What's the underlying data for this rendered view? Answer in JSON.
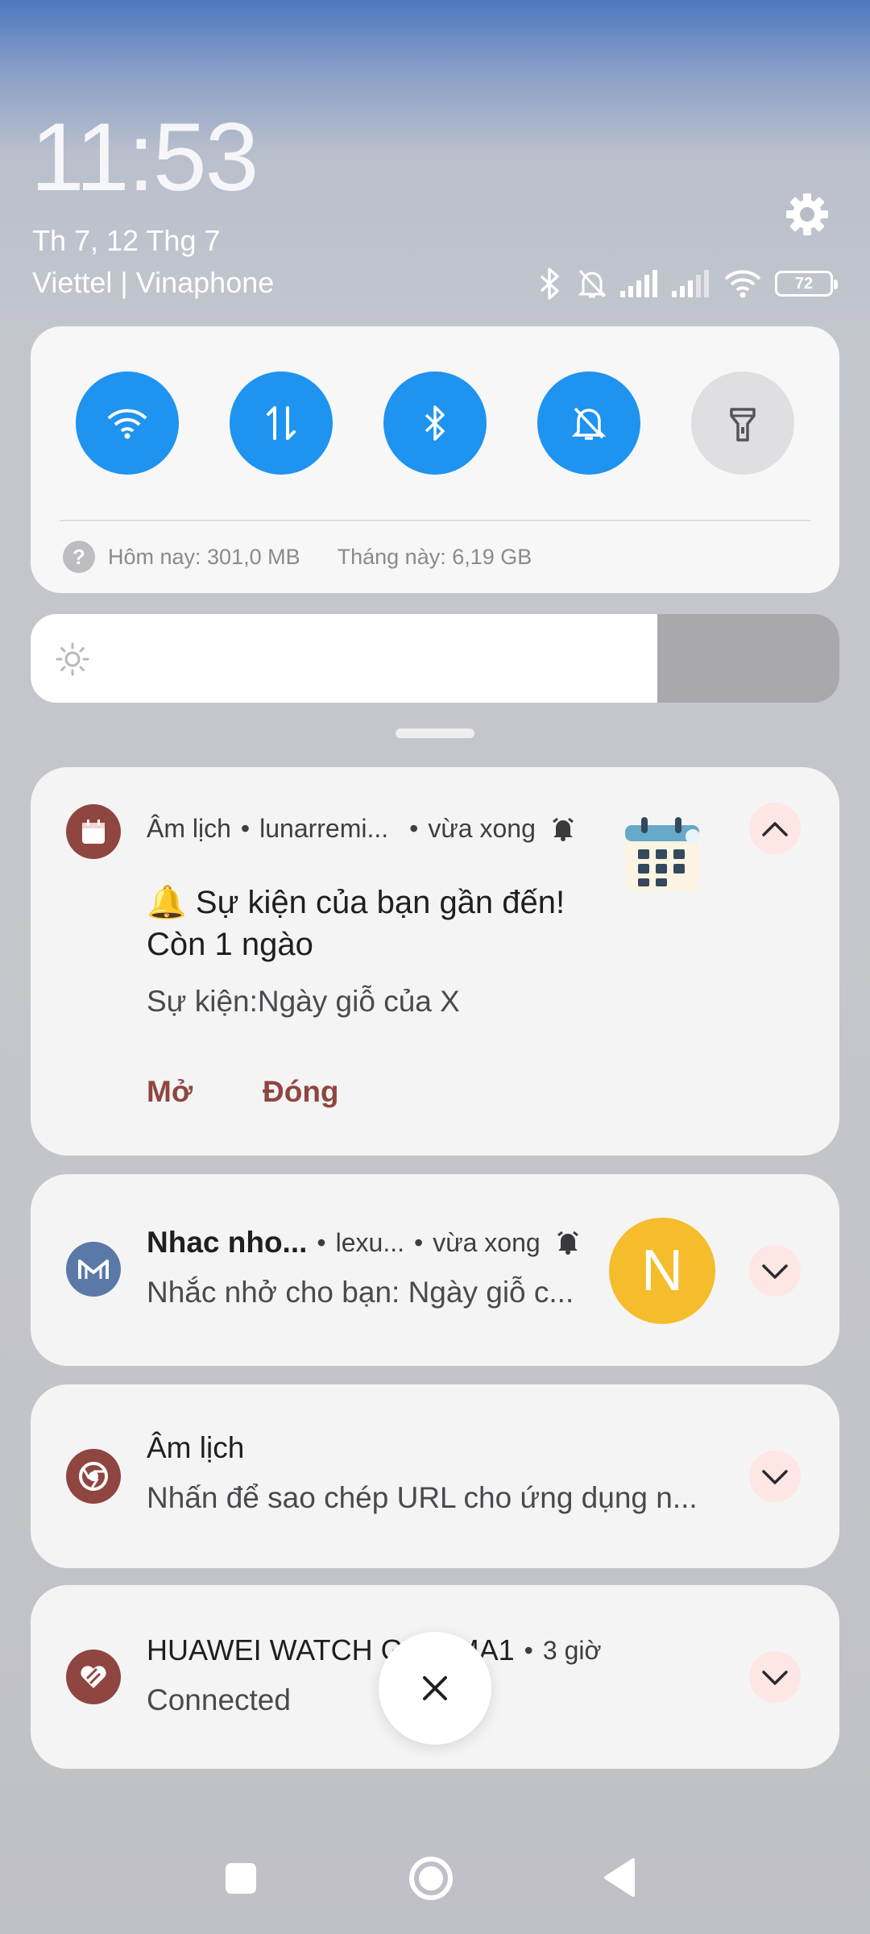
{
  "status": {
    "time": "11:53",
    "date": "Th 7, 12 Thg 7",
    "carrier": "Viettel | Vinaphone",
    "battery": "72",
    "icons": [
      "bluetooth-icon",
      "muted-bell-icon",
      "signal-icon",
      "signal-icon",
      "wifi-icon",
      "battery-icon"
    ]
  },
  "quick_settings": {
    "toggles": [
      {
        "name": "wifi",
        "icon": "wifi-icon",
        "on": true
      },
      {
        "name": "mobile-data",
        "icon": "data-arrows-icon",
        "on": true
      },
      {
        "name": "bluetooth",
        "icon": "bluetooth-icon",
        "on": true
      },
      {
        "name": "silent",
        "icon": "muted-bell-icon",
        "on": true
      },
      {
        "name": "flashlight",
        "icon": "flashlight-icon",
        "on": false
      }
    ],
    "usage_today": "Hôm nay: 301,0 MB",
    "usage_month": "Tháng này: 6,19 GB"
  },
  "brightness": {
    "level": 0.775
  },
  "notifications": [
    {
      "app": "Âm lịch",
      "source": "lunarremi...",
      "time": "vừa xong",
      "title": "🔔 Sự kiện của bạn gần đến! Còn 1 ngào",
      "body": "Sự kiện:Ngày giỗ của X",
      "actions": [
        "Mở",
        "Đóng"
      ],
      "expanded": true,
      "icon_color": "#8f4640"
    },
    {
      "app": "Nhac nho...",
      "source": "lexu...",
      "time": "vừa xong",
      "body": "Nhắc nhở cho bạn: Ngày giỗ c...",
      "avatar_letter": "N",
      "avatar_color": "#f5bd2b",
      "icon_color": "#5a78a8"
    },
    {
      "app": "Âm lịch",
      "body": "Nhấn để sao chép URL cho ứng dụng n...",
      "icon_color": "#8f4640"
    },
    {
      "app": "HUAWEI WATCH G",
      "app_tail": "MA1",
      "time": "3 giờ",
      "body": "Connected",
      "icon_color": "#8f4640"
    }
  ],
  "colors": {
    "accent": "#1e93f0",
    "action": "#8f4640",
    "card": "#f5f4f5"
  }
}
